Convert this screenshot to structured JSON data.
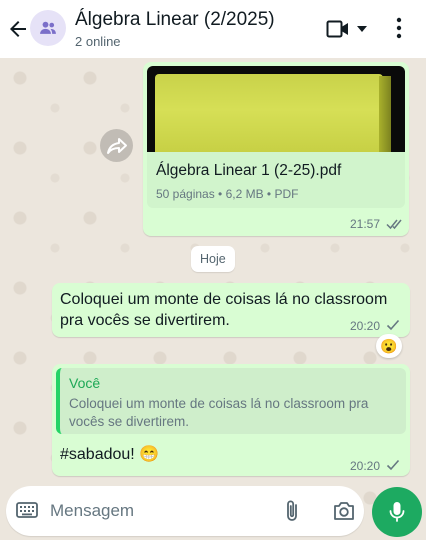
{
  "header": {
    "title": "Álgebra Linear (2/2025)",
    "subtitle": "2 online"
  },
  "document_message": {
    "file_name": "Álgebra Linear 1 (2-25).pdf",
    "meta": "50 páginas • 6,2 MB • PDF",
    "time": "21:57"
  },
  "date_chip": "Hoje",
  "message1": {
    "text": "Coloquei um monte de coisas lá no classroom pra vocês se divertirem.",
    "time": "20:20",
    "reaction": "😮"
  },
  "message2": {
    "quote_author": "Você",
    "quote_text": "Coloquei um monte de coisas lá no classroom pra vocês se divertirem.",
    "text": "#sabadou! 😁",
    "time": "20:20"
  },
  "input": {
    "placeholder": "Mensagem"
  },
  "colors": {
    "outgoing_bubble": "#d9fdd3",
    "accent_green": "#1daa61",
    "read_ticks": "#667781"
  }
}
